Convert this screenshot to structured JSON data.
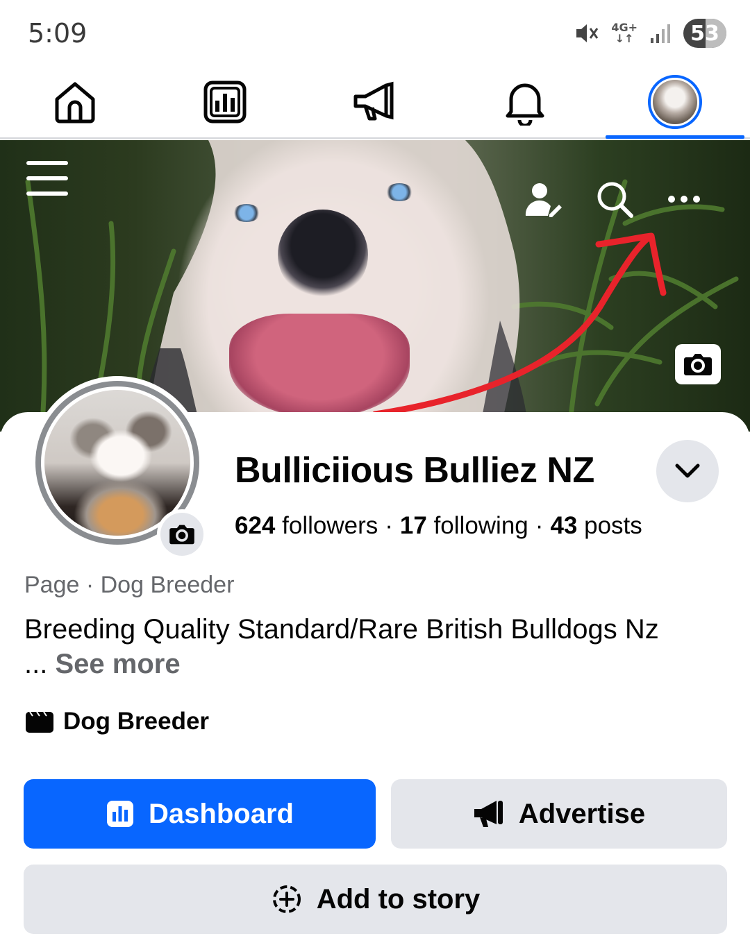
{
  "status_bar": {
    "time": "5:09",
    "network": "4G+",
    "battery": "53"
  },
  "nav": {
    "items": [
      {
        "name": "home",
        "icon": "home-icon"
      },
      {
        "name": "dashboard",
        "icon": "dashboard-icon"
      },
      {
        "name": "advertise",
        "icon": "megaphone-icon"
      },
      {
        "name": "notifications",
        "icon": "bell-icon"
      },
      {
        "name": "profile",
        "icon": "avatar",
        "active": true
      }
    ],
    "accent": "#0866ff"
  },
  "cover": {
    "actions": [
      "menu-icon",
      "manage-profile-icon",
      "search-icon",
      "more-icon",
      "camera-icon"
    ],
    "annotation_color": "#e8232b"
  },
  "profile": {
    "name": "Bulliciious Bulliez NZ",
    "followers_count": "624",
    "followers_label": "followers",
    "following_count": "17",
    "following_label": "following",
    "posts_count": "43",
    "posts_label": "posts",
    "separator": "·",
    "category_line": "Page · Dog Breeder",
    "bio": "Breeding Quality Standard/Rare British Bulldogs Nz",
    "bio_ellipsis": "...",
    "see_more": "See more",
    "detail_category": "Dog Breeder"
  },
  "actions": {
    "dashboard": "Dashboard",
    "advertise": "Advertise",
    "add_to_story": "Add to story"
  }
}
